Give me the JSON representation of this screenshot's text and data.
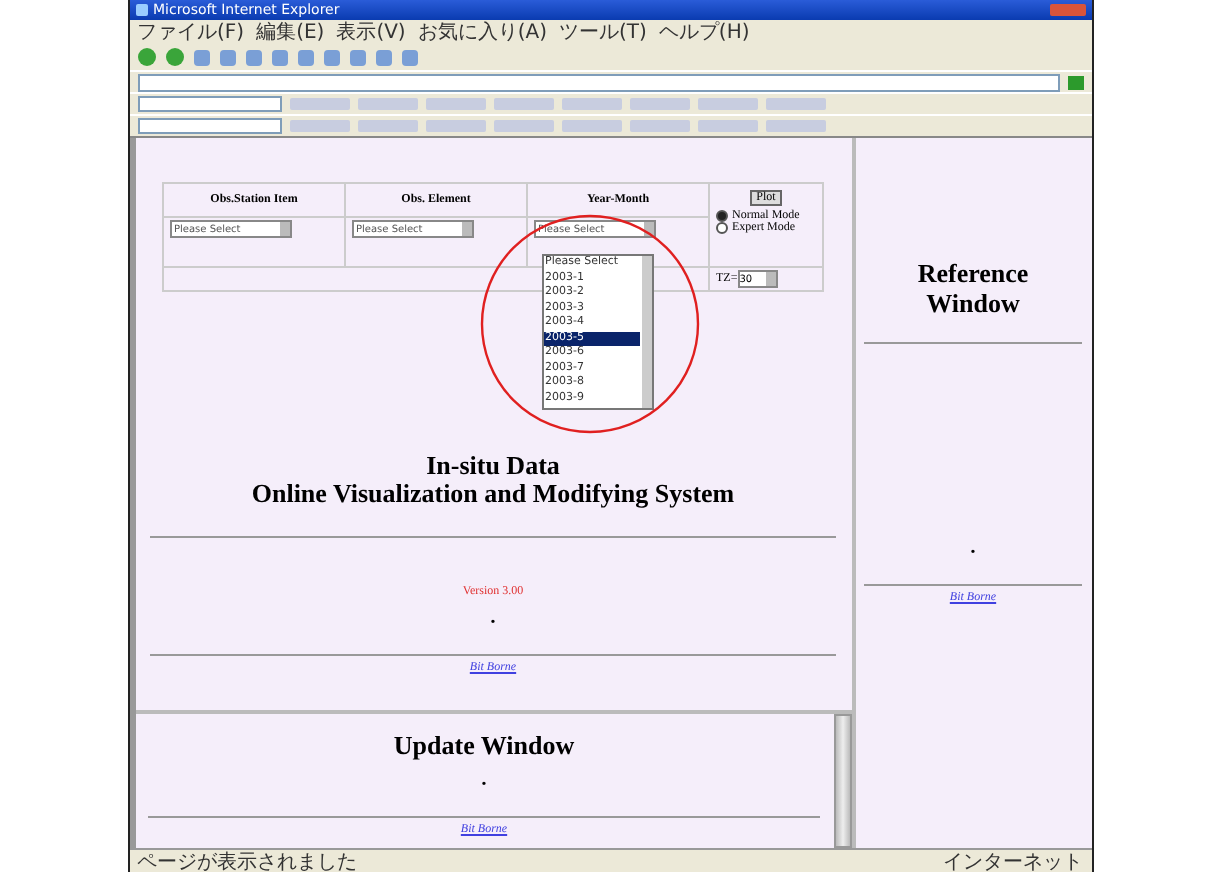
{
  "window": {
    "title": "Microsoft Internet Explorer"
  },
  "menu": [
    "ファイル(F)",
    "編集(E)",
    "表示(V)",
    "お気に入り(A)",
    "ツール(T)",
    "ヘルプ(H)"
  ],
  "form": {
    "columns": [
      "Obs.Station Item",
      "Obs. Element",
      "Year-Month"
    ],
    "selects": [
      "Please Select",
      "Please Select",
      "Please Select"
    ],
    "dropdown": [
      {
        "label": "Please Select",
        "selected": false
      },
      {
        "label": "2003-1",
        "selected": false
      },
      {
        "label": "2003-2",
        "selected": false
      },
      {
        "label": "2003-3",
        "selected": false
      },
      {
        "label": "2003-4",
        "selected": false
      },
      {
        "label": "2003-5",
        "selected": true
      },
      {
        "label": "2003-6",
        "selected": false
      },
      {
        "label": "2003-7",
        "selected": false
      },
      {
        "label": "2003-8",
        "selected": false
      },
      {
        "label": "2003-9",
        "selected": false
      }
    ],
    "plot_button": "Plot",
    "modes": [
      {
        "label": "Normal Mode",
        "selected": true
      },
      {
        "label": "Expert Mode",
        "selected": false
      }
    ],
    "tz_label": "TZ=",
    "tz_value": "30"
  },
  "main": {
    "title_lines": [
      "In-situ Data",
      "Online Visualization and Modifying System"
    ],
    "version": "Version 3.00",
    "dot": "•",
    "link": "Bit Borne"
  },
  "update": {
    "title": "Update Window",
    "dot": "•",
    "link": "Bit Borne"
  },
  "reference": {
    "title_lines": [
      "Reference",
      "Window"
    ],
    "dot": "•",
    "link": "Bit Borne"
  },
  "status_bar": {
    "message": "ページが表示されました",
    "zone": "インターネット"
  }
}
